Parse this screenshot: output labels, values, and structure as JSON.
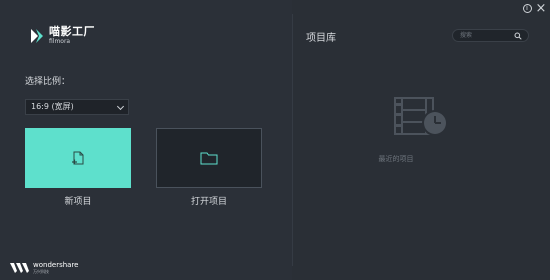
{
  "window": {
    "help_icon": "help-circle-icon",
    "close_icon": "close-icon",
    "close_glyph": "×",
    "help_glyph": "i"
  },
  "logo": {
    "name_cn": "喵影工厂",
    "name_en": "filmora",
    "icon": "filmora-logo-icon"
  },
  "left": {
    "ratio_label": "选择比例：",
    "ratio_selected": "16:9 (宽屏)",
    "new_project_label": "新项目",
    "open_project_label": "打开项目",
    "new_project_icon": "new-file-icon",
    "open_project_icon": "folder-icon",
    "accent_color": "#5ee0cc"
  },
  "right": {
    "title": "项目库",
    "search_placeholder": "搜索",
    "search_icon": "search-icon",
    "empty_text": "最近的项目",
    "empty_icon": "film-clock-icon"
  },
  "brand": {
    "name_en": "wondershare",
    "name_cn": "万兴科技",
    "icon": "wondershare-logo-icon"
  }
}
